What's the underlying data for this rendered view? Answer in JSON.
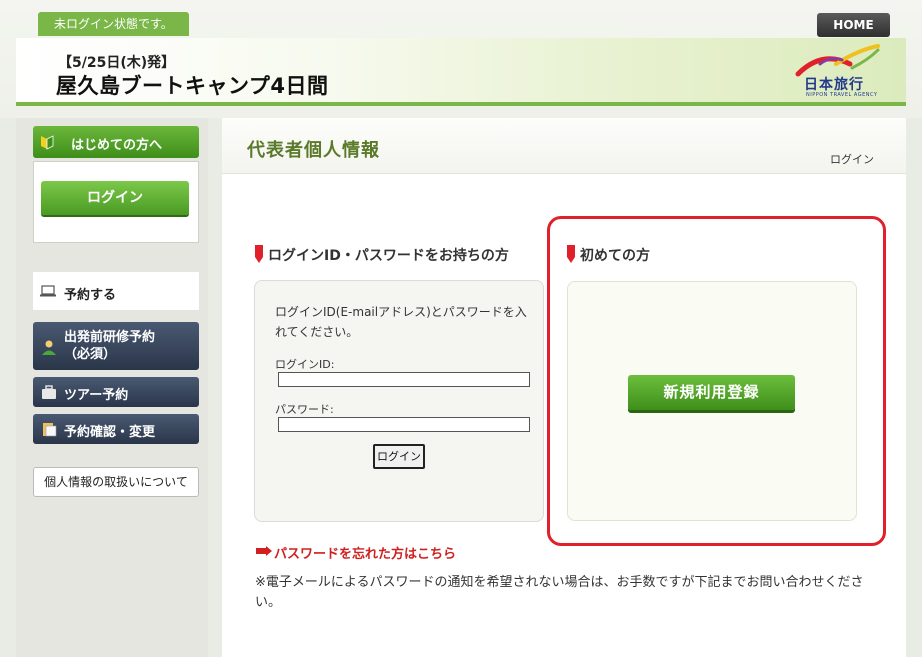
{
  "header": {
    "login_status": "未ログイン状態です。",
    "home_label": "HOME",
    "tour_date": "【5/25日(木)発】",
    "tour_title": "屋久島ブートキャンプ4日間",
    "logo_text": "日本旅行",
    "logo_sub": "NIPPON TRAVEL AGENCY"
  },
  "sidebar": {
    "first_time_label": "はじめての方へ",
    "login_button": "ログイン",
    "reserve_heading": "予約する",
    "nav": {
      "training_line1": "出発前研修予約",
      "training_line2": "（必須）",
      "tour": "ツアー予約",
      "confirm": "予約確認・変更"
    },
    "privacy_link": "個人情報の取扱いについて"
  },
  "main": {
    "page_title": "代表者個人情報",
    "breadcrumb": "ログイン",
    "has_account": {
      "heading": "ログインID・パスワードをお持ちの方",
      "description": "ログインID(E-mailアドレス)とパスワードを入れてください。",
      "id_label": "ログインID:",
      "id_value": "",
      "password_label": "パスワード:",
      "password_value": "",
      "submit": "ログイン"
    },
    "first_time": {
      "heading": "初めての方",
      "register_button": "新規利用登録"
    },
    "forgot_password": "パスワードを忘れた方はこちら",
    "note": "※電子メールによるパスワードの通知を希望されない場合は、お手数ですが下記までお問い合わせください。"
  },
  "colors": {
    "brand_green": "#7ab648",
    "highlight_red": "#e0202a",
    "nav_dark": "#2a3549",
    "title_green": "#5a7a2a"
  }
}
